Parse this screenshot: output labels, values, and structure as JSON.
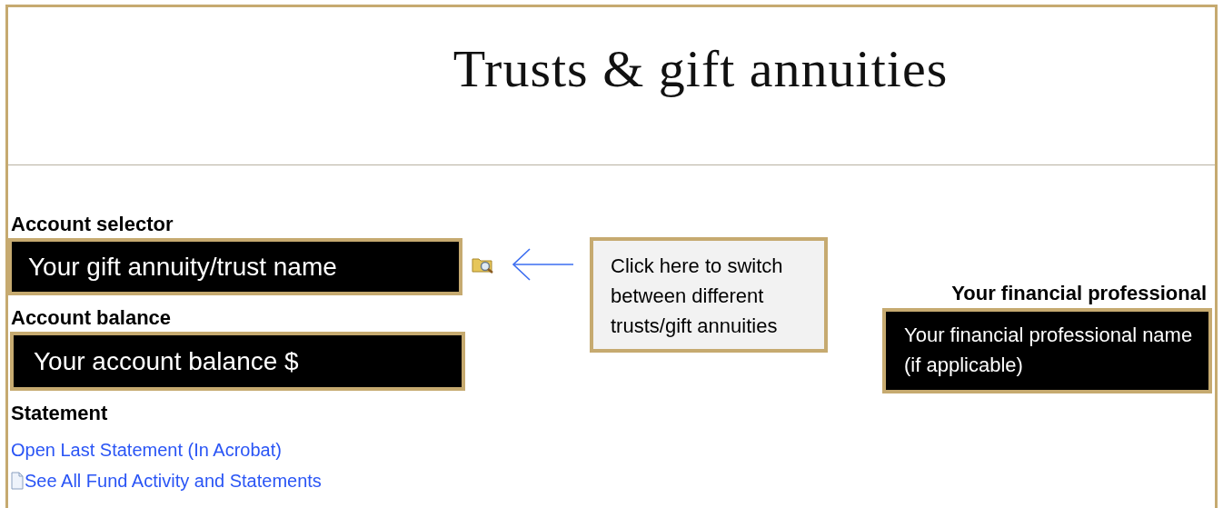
{
  "title": "Trusts & gift annuities",
  "account_selector": {
    "label": "Account selector",
    "value": "Your gift annuity/trust name"
  },
  "account_balance": {
    "label": "Account balance",
    "value": "Your account balance $"
  },
  "statement": {
    "label": "Statement",
    "links": [
      {
        "text": "Open Last Statement (In Acrobat)",
        "kind": "plain"
      },
      {
        "text": "See All Fund Activity and Statements",
        "kind": "document"
      }
    ]
  },
  "callout": {
    "text": "Click here to switch between different trusts/gift annuities"
  },
  "financial_professional": {
    "label": "Your financial professional",
    "value": "Your financial professional name (if applicable)"
  }
}
